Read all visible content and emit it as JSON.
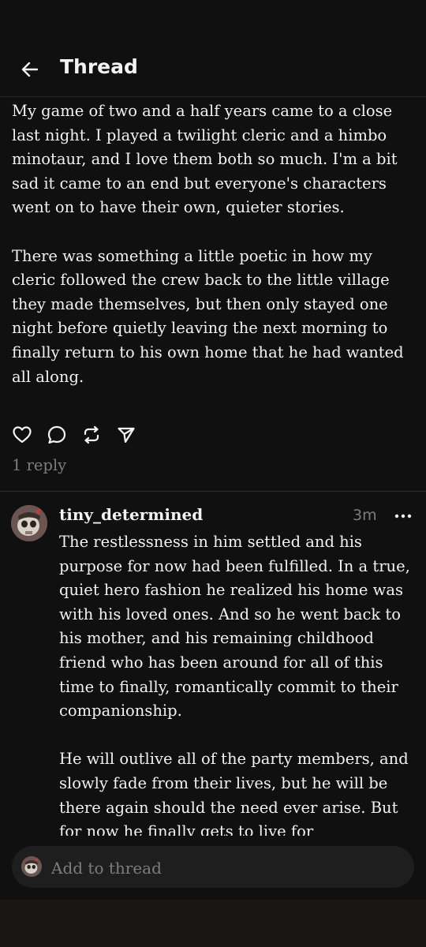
{
  "header": {
    "title": "Thread"
  },
  "post": {
    "paragraphs": [
      "My game of two and a half years  came to a close last night. I played a twilight cleric and a himbo minotaur, and I love them both so much. I'm a bit sad it came to an end but everyone's characters went on to have their own, quieter stories.",
      "There was something a little poetic in how my cleric followed the crew back to the little village they made themselves, but then only stayed one night before quietly leaving the next morning to finally return to his own home that he had wanted all along."
    ],
    "actions": [
      "heart-icon",
      "comment-icon",
      "repost-icon",
      "share-icon"
    ],
    "reply_count": "1 reply"
  },
  "reply": {
    "username": "tiny_determined",
    "time": "3m",
    "paragraphs": [
      "The restlessness in him settled and his purpose for now had been fulfilled. In a true, quiet hero fashion he realized his home was with his loved ones. And so he went back to his mother, and his remaining childhood friend who has been around for all of this time to finally, romantically commit to their companionship.",
      "He will outlive all of the party members, and slowly fade from their lives, but he will be there again should the need ever arise. But for now he finally gets to live for"
    ]
  },
  "composer": {
    "placeholder": "Add to thread"
  }
}
